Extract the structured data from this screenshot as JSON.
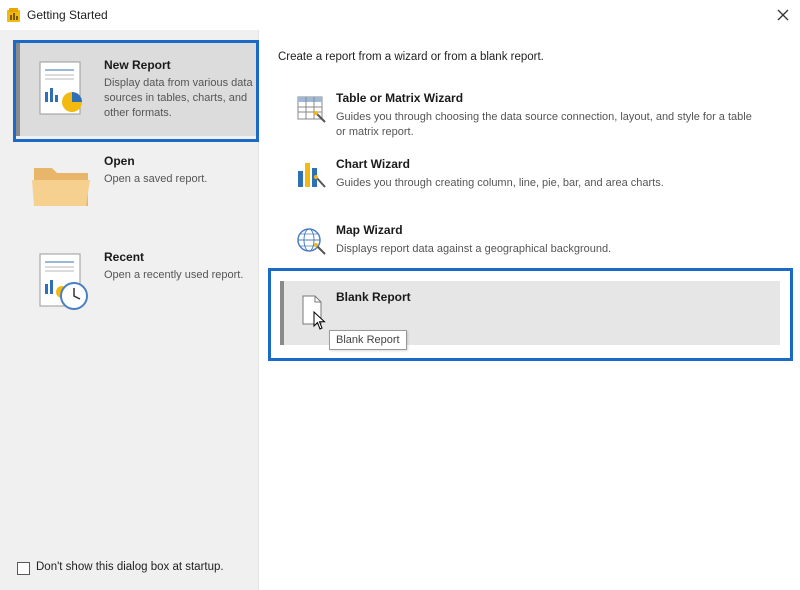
{
  "window": {
    "title": "Getting Started"
  },
  "sidebar": {
    "items": [
      {
        "title": "New Report",
        "description": "Display data from various data sources in tables, charts, and other formats."
      },
      {
        "title": "Open",
        "description": "Open a saved report."
      },
      {
        "title": "Recent",
        "description": "Open a recently used report."
      }
    ]
  },
  "main": {
    "caption": "Create a report from a wizard or from a blank report.",
    "options": [
      {
        "title": "Table or Matrix Wizard",
        "description": "Guides you through choosing the data source connection, layout, and style for a table or matrix report."
      },
      {
        "title": "Chart Wizard",
        "description": "Guides you through creating column, line, pie, bar, and area charts."
      },
      {
        "title": "Map Wizard",
        "description": "Displays report data against a geographical background."
      },
      {
        "title": "Blank Report",
        "description": ""
      }
    ],
    "tooltip": "Blank Report"
  },
  "footer": {
    "checkbox_label": "Don't show this dialog box at startup.",
    "checked": false
  },
  "colors": {
    "highlight": "#1b6ac6",
    "selected_bg": "#dcdcdc",
    "sidebar_bg": "#f0f0f0",
    "accent_yellow": "#f2b90f"
  },
  "icons": {
    "app": "report-builder-icon",
    "close": "close-icon",
    "new_report": "new-report-icon",
    "open": "folder-icon",
    "recent": "recent-report-icon",
    "table_wizard": "table-wizard-icon",
    "chart_wizard": "chart-wizard-icon",
    "map_wizard": "map-wizard-icon",
    "blank_report": "blank-report-icon"
  }
}
